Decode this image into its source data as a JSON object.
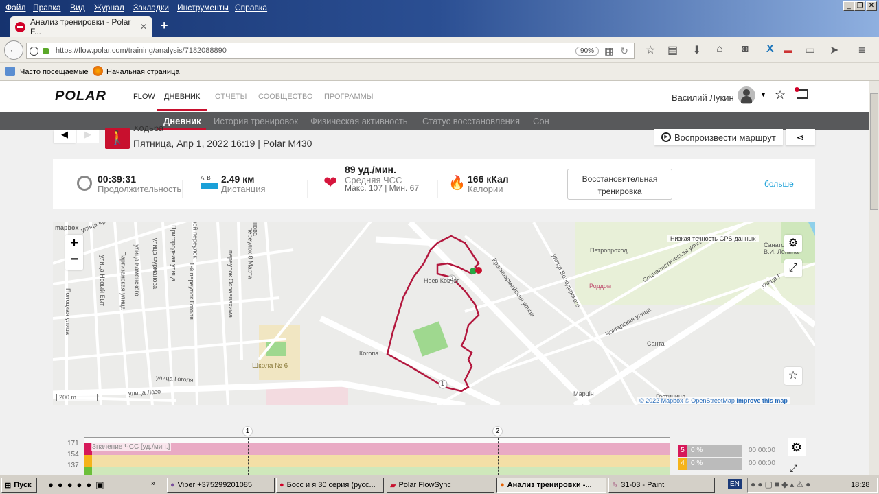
{
  "browser": {
    "menu": [
      "Файл",
      "Правка",
      "Вид",
      "Журнал",
      "Закладки",
      "Инструменты",
      "Справка"
    ],
    "tab_title": "Анализ тренировки - Polar F...",
    "url": "https://flow.polar.com/training/analysis/7182088890",
    "zoom": "90%",
    "bookmarks": [
      "Часто посещаемые",
      "Начальная страница"
    ]
  },
  "header": {
    "logo": "POLAR",
    "flow": "FLOW",
    "nav": [
      "ДНЕВНИК",
      "ОТЧЕТЫ",
      "СООБЩЕСТВО",
      "ПРОГРАММЫ"
    ],
    "user": "Василий Лукин"
  },
  "subnav": [
    "Дневник",
    "История тренировок",
    "Физическая активность",
    "Статус восстановления",
    "Сон"
  ],
  "training": {
    "sport": "Ходьба",
    "subtitle": "Пятница, Апр 1, 2022 16:19 | Polar M430",
    "replay": "Воспроизвести маршрут"
  },
  "stats": {
    "duration": {
      "value": "00:39:31",
      "label": "Продолжительность"
    },
    "distance": {
      "value": "2.49 км",
      "label": "Дистанция",
      "ab": "A  B"
    },
    "hr": {
      "value": "89 уд./мин.",
      "label": "Средняя ЧСС",
      "minmax": "Макс. 107  |  Мин. 67"
    },
    "calories": {
      "value": "166 кКал",
      "label": "Калории"
    },
    "benefit": "Восстановительная тренировка",
    "more": "больше"
  },
  "map": {
    "attribution_logo": "mapbox",
    "scale": "200 m",
    "gps_legend": "Низкая точность GPS-данных",
    "copyright": "© 2022 Mapbox © OpenStreetMap",
    "improve": "Improve this map",
    "labels": [
      "улица Кр",
      "Полоцкая улица",
      "улица Новый Быт",
      "Партизанская улица",
      "улица Каменского",
      "улица Фурманова",
      "Пригородная улица",
      "зой переулок",
      "1-й переулок Гоголя",
      "переулок Осоавиахима",
      "переулок 8 Марта",
      "нова",
      "Школа № 6",
      "улица Гоголя",
      "улица Лазо",
      "Когопа",
      "Ноев Ковчег",
      "Красноармейская улица",
      "улица Володарского",
      "Петропроход",
      "Роддом",
      "Социалистическая улица",
      "Чонгарская улица",
      "Санта",
      "Марцін",
      "Гостиница",
      "Санаторий В.И. Ленина",
      "улица Г"
    ],
    "laps": [
      "1",
      "2"
    ]
  },
  "hrchart": {
    "legend": "Значение ЧСС [уд./мин.]",
    "yticks": [
      "171",
      "154",
      "137"
    ],
    "markers": [
      "1",
      "2"
    ],
    "zones": [
      {
        "zone": "5",
        "pct": "0 %",
        "time": "00:00:00",
        "color": "#d6195a"
      },
      {
        "zone": "4",
        "pct": "0 %",
        "time": "00:00:00",
        "color": "#f5b31b"
      }
    ]
  },
  "taskbar": {
    "start": "Пуск",
    "items": [
      "Viber +375299201085",
      "Босс и я 30 серия (русс...",
      "Polar FlowSync",
      "Анализ тренировки -...",
      "31-03 - Paint"
    ],
    "lang": "EN",
    "clock": "18:28"
  }
}
